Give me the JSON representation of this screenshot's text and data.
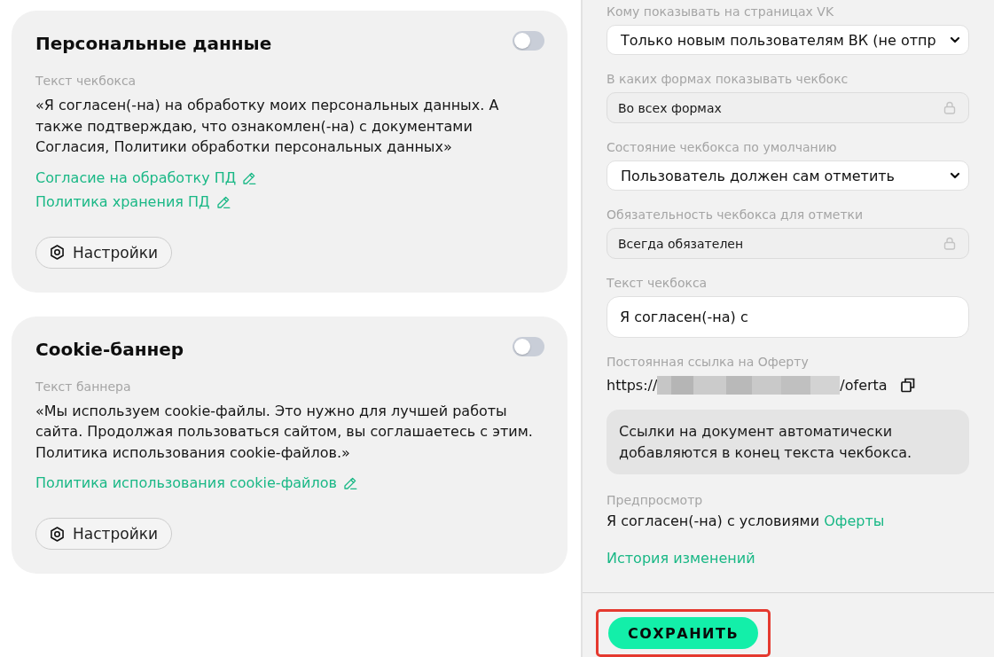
{
  "cards": [
    {
      "title": "Персональные данные",
      "enabled": false,
      "field_label": "Текст чекбокса",
      "text": "«Я согласен(-на) на обработку моих персональных данных. А также подтверждаю, что ознакомлен(-на) с документами Согласия, Политики обработки персональных данных»",
      "links": [
        "Согласие на обработку ПД",
        "Политика хранения ПД"
      ],
      "button": "Настройки"
    },
    {
      "title": "Cookie-баннер",
      "enabled": false,
      "field_label": "Текст баннера",
      "text": "«Мы используем cookie-файлы. Это нужно для лучшей работы сайта. Продолжая пользоваться сайтом, вы соглашаетесь с этим. Политика использования cookie-файлов.»",
      "links": [
        "Политика использования cookie-файлов"
      ],
      "button": "Настройки"
    }
  ],
  "settings": {
    "fields": [
      {
        "kind": "select",
        "label": "Кому показывать на страницах VK",
        "value": "Только новым пользователям ВК (не отпр"
      },
      {
        "kind": "locked",
        "label": "В каких формах показывать чекбокс",
        "value": "Во всех формах"
      },
      {
        "kind": "select",
        "label": "Состояние чекбокса по умолчанию",
        "value": "Пользователь должен сам отметить"
      },
      {
        "kind": "locked",
        "label": "Обязательность чекбокса для отметки",
        "value": "Всегда обязателен"
      },
      {
        "kind": "input",
        "label": "Текст чекбокса",
        "value": "Я согласен(-на) с"
      }
    ],
    "offer_link": {
      "label": "Постоянная ссылка на Оферту",
      "prefix": "https://",
      "redacted": true,
      "suffix": "/oferta"
    },
    "note": "Ссылки на документ автоматически добавляются в конец текста чекбокса.",
    "preview": {
      "label": "Предпросмотр",
      "text": "Я согласен(-на) с условиями",
      "link": "Оферты"
    },
    "history_link": "История изменений"
  },
  "save_button": {
    "label": "СОХРАНИТЬ",
    "highlighted": true
  }
}
